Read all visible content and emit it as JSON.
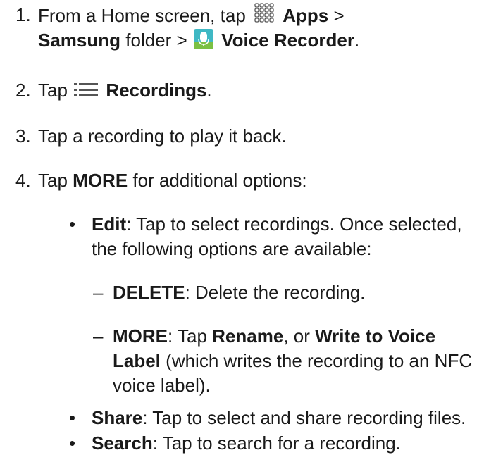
{
  "steps": [
    {
      "number": "1.",
      "line1_a": "From a Home screen, tap",
      "apps_label": "Apps",
      "line1_b": ">",
      "samsung_label": "Samsung",
      "line2_a": "folder >",
      "voice_recorder_label": "Voice Recorder",
      "line2_end": "."
    },
    {
      "number": "2.",
      "text_a": "Tap",
      "recordings_label": "Recordings",
      "text_end": "."
    },
    {
      "number": "3.",
      "text": "Tap a recording to play it back."
    },
    {
      "number": "4.",
      "text_a": "Tap",
      "more_label": "MORE",
      "text_b": "for additional options:"
    }
  ],
  "options": {
    "edit": {
      "label": "Edit",
      "line1": ": Tap to select recordings. Once selected,",
      "line2": "the following options are available:",
      "suboptions": {
        "delete": {
          "label": "DELETE",
          "text": ": Delete the recording."
        },
        "more": {
          "label": "MORE",
          "text_a": ": Tap",
          "rename_label": "Rename",
          "text_b": ", or",
          "write_label_a": "Write to Voice",
          "write_label_b": "Label",
          "text_c": "(which writes the recording to an NFC",
          "text_d": "voice label)."
        }
      }
    },
    "share": {
      "label": "Share",
      "text": ": Tap to select and share recording files."
    },
    "search": {
      "label": "Search",
      "text": ": Tap to search for a recording."
    }
  },
  "glyphs": {
    "bullet": "•",
    "dash": "–"
  },
  "icons": {
    "apps": "apps-grid-icon",
    "voice_recorder": "microphone-app-icon",
    "recordings": "list-icon"
  },
  "colors": {
    "text": "#1a1a1a",
    "icon_teal": "#3fb8c4",
    "icon_green": "#7bc043",
    "icon_gray": "#555555"
  }
}
